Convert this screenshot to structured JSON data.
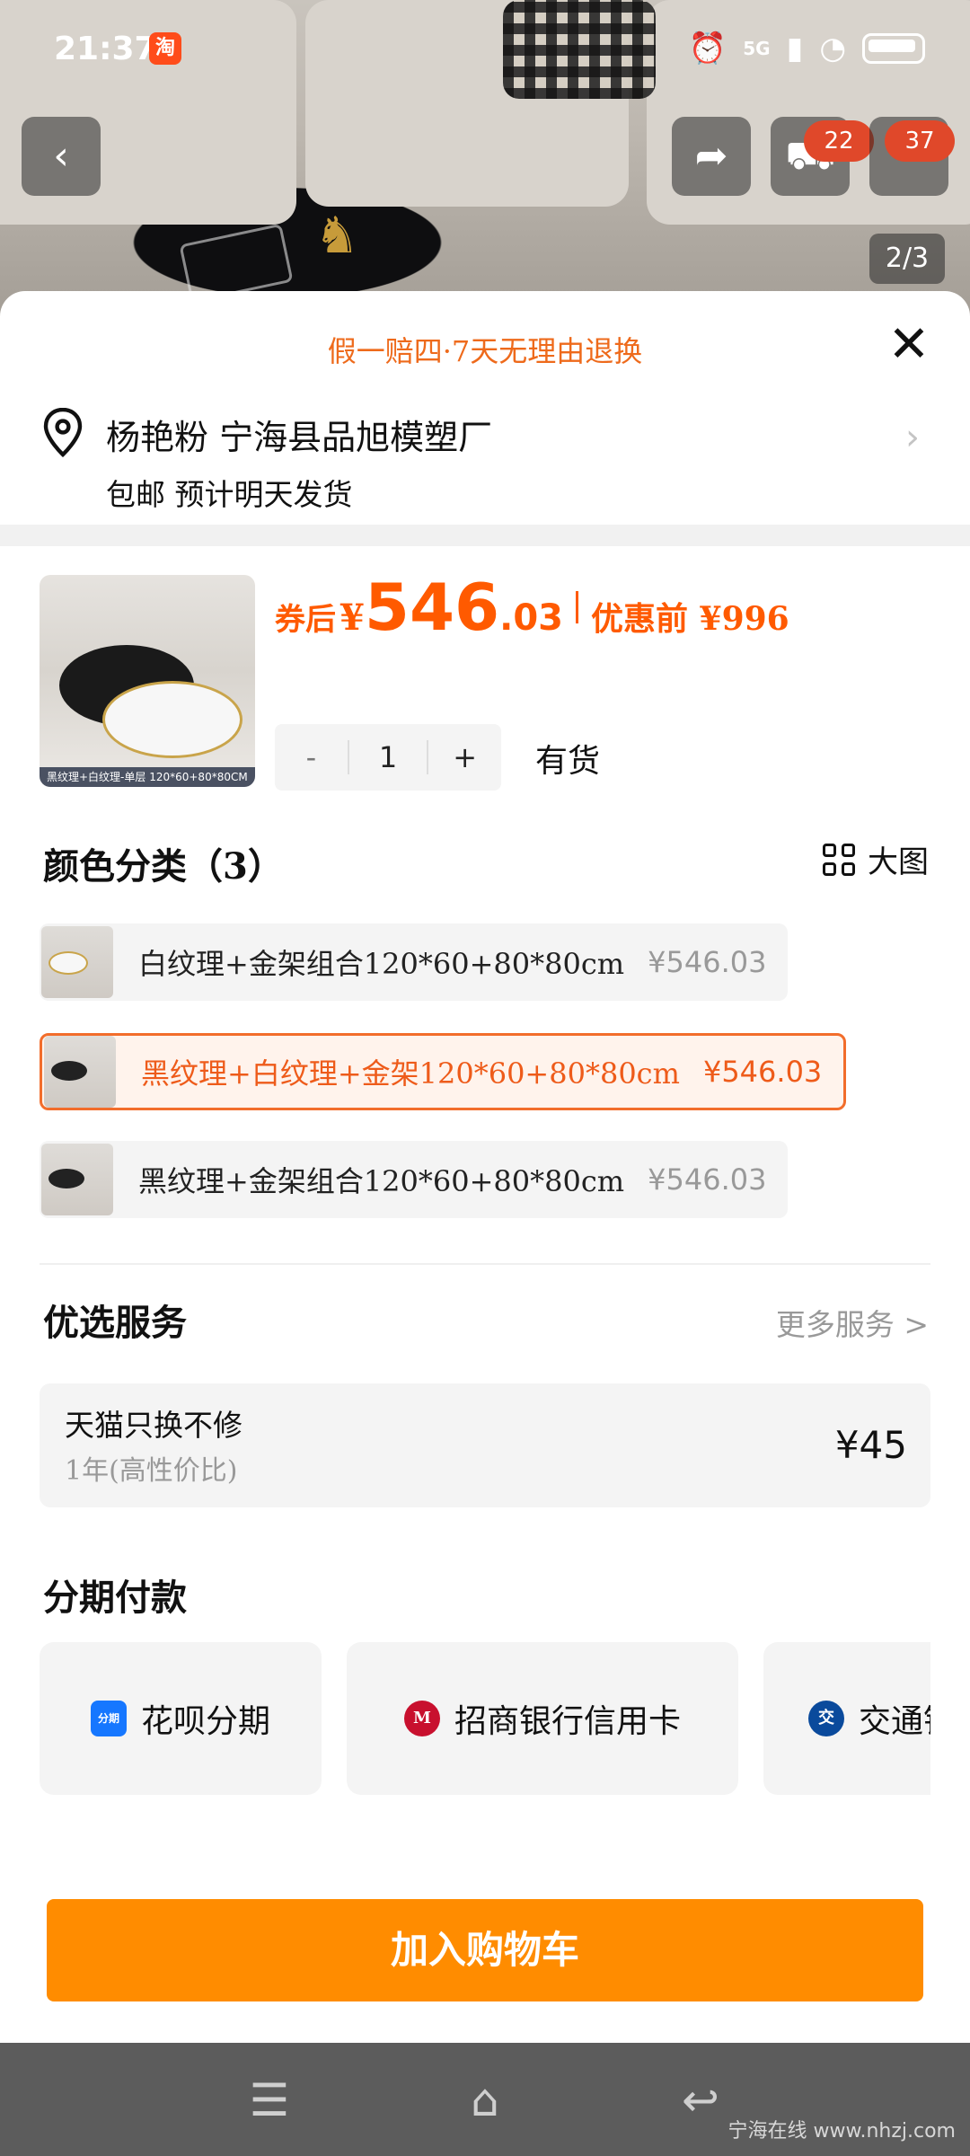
{
  "status_bar": {
    "time": "21:37",
    "app_badge": "淘",
    "network": "5G"
  },
  "top_bar": {
    "cart_count": "22",
    "message_count": "37",
    "page_indicator": "2/3"
  },
  "sheet": {
    "promo": "假一赔四·7天无理由退换",
    "close_symbol": "✕",
    "address": "杨艳粉 宁海县品旭模塑厂",
    "shipping": "包邮 预计明天发货",
    "product_caption": "黑纹理+白纹理-单层    120*60+80*80CM",
    "price": {
      "after_label": "券后",
      "yen": "¥",
      "int": "546",
      "dec": ".03",
      "before": "优惠前 ¥996"
    },
    "quantity": {
      "minus": "-",
      "value": "1",
      "plus": "+"
    },
    "stock": "有货"
  },
  "color_section": {
    "title": "颜色分类（3）",
    "big_image_label": "大图",
    "variants": [
      {
        "label": "白纹理+金架组合120*60+80*80cm",
        "price": "¥546.03"
      },
      {
        "label": "黑纹理+白纹理+金架120*60+80*80cm",
        "price": "¥546.03"
      },
      {
        "label": "黑纹理+金架组合120*60+80*80cm",
        "price": "¥546.03"
      }
    ]
  },
  "service_section": {
    "title": "优选服务",
    "more": "更多服务 >",
    "card": {
      "name": "天猫只换不修",
      "desc": "1年(高性价比)",
      "price": "¥45"
    }
  },
  "installment_section": {
    "title": "分期付款",
    "options": [
      {
        "label": "花呗分期",
        "icon": "分期",
        "color": "#1677ff"
      },
      {
        "label": "招商银行信用卡",
        "icon": "M",
        "color": "#c8102e"
      },
      {
        "label": "交通银行",
        "icon": "交",
        "color": "#0a4a9c"
      }
    ]
  },
  "cta": {
    "label": "加入购物车",
    "color": "#ff8c00"
  },
  "nav": {
    "menu": "☰",
    "home": "⌂",
    "back": "↩"
  },
  "watermark": "宁海在线 www.nhzj.com"
}
